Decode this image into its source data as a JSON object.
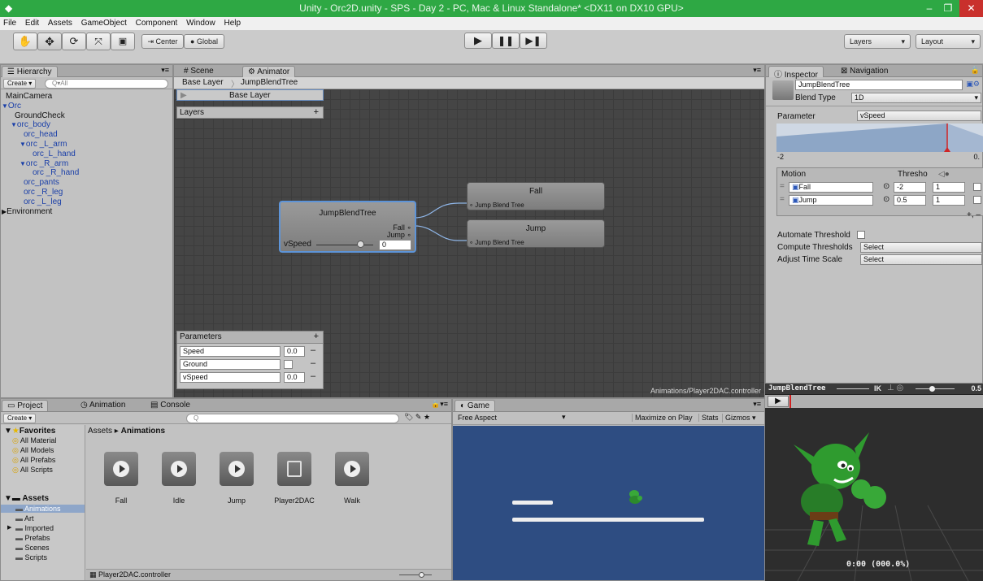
{
  "window": {
    "title": "Unity - Orc2D.unity - SPS - Day 2 - PC, Mac & Linux Standalone* <DX11 on DX10 GPU>",
    "minimize": "–",
    "restore": "❐",
    "close": "✕"
  },
  "menu": [
    "File",
    "Edit",
    "Assets",
    "GameObject",
    "Component",
    "Window",
    "Help"
  ],
  "toolbar": {
    "center": "Center",
    "global": "Global",
    "layers": "Layers",
    "layout": "Layout"
  },
  "hierarchy": {
    "tab": "Hierarchy",
    "create": "Create",
    "search_placeholder": "Q▾All",
    "items": [
      {
        "label": "MainCamera",
        "indent": 0,
        "arrow": "",
        "blue": false
      },
      {
        "label": "Orc",
        "indent": 0,
        "arrow": "▼",
        "blue": true
      },
      {
        "label": "GroundCheck",
        "indent": 1,
        "arrow": "",
        "blue": false
      },
      {
        "label": "orc_body",
        "indent": 1,
        "arrow": "▼",
        "blue": true
      },
      {
        "label": "orc_head",
        "indent": 2,
        "arrow": "",
        "blue": true
      },
      {
        "label": "orc _L_arm",
        "indent": 2,
        "arrow": "▼",
        "blue": true
      },
      {
        "label": "orc_L_hand",
        "indent": 3,
        "arrow": "",
        "blue": true
      },
      {
        "label": "orc _R_arm",
        "indent": 2,
        "arrow": "▼",
        "blue": true
      },
      {
        "label": "orc _R_hand",
        "indent": 3,
        "arrow": "",
        "blue": true
      },
      {
        "label": "orc_pants",
        "indent": 2,
        "arrow": "",
        "blue": true
      },
      {
        "label": "orc _R_leg",
        "indent": 2,
        "arrow": "",
        "blue": true
      },
      {
        "label": "orc _L_leg",
        "indent": 2,
        "arrow": "",
        "blue": true
      },
      {
        "label": "Environment",
        "indent": 0,
        "arrow": "▶",
        "blue": false
      }
    ]
  },
  "animator": {
    "tab_scene": "Scene",
    "tab_animator": "Animator",
    "breadcrumb": [
      "Base Layer",
      "JumpBlendTree"
    ],
    "base_layer": "Base Layer",
    "layers": "Layers",
    "blendtree": {
      "title": "JumpBlendTree",
      "out_fall": "Fall",
      "out_jump": "Jump",
      "param": "vSpeed",
      "value": "0"
    },
    "nodes": [
      {
        "name": "Fall",
        "sub": "Jump Blend Tree"
      },
      {
        "name": "Jump",
        "sub": "Jump Blend Tree"
      }
    ],
    "parameters": {
      "header": "Parameters",
      "rows": [
        {
          "name": "Speed",
          "value": "0.0"
        },
        {
          "name": "Ground",
          "value": ""
        },
        {
          "name": "vSpeed",
          "value": "0.0"
        }
      ]
    },
    "path": "Animations/Player2DAC.controller"
  },
  "inspector": {
    "tab_inspector": "Inspector",
    "tab_navigation": "Navigation",
    "name": "JumpBlendTree",
    "blend_type_label": "Blend Type",
    "blend_type": "1D",
    "parameter_label": "Parameter",
    "parameter": "vSpeed",
    "range_min": "-2",
    "range_max": "0.",
    "motion_header": "Motion",
    "threshold_header": "Thresho",
    "motions": [
      {
        "name": "Fall",
        "threshold": "-2",
        "speed": "1"
      },
      {
        "name": "Jump",
        "threshold": "0.5",
        "speed": "1"
      }
    ],
    "add_remove": "+, –",
    "automate_label": "Automate Threshold",
    "compute_label": "Compute Thresholds",
    "compute_value": "Select",
    "adjust_label": "Adjust Time Scale",
    "adjust_value": "Select"
  },
  "preview": {
    "title": "JumpBlendTree",
    "ik": "IK",
    "value": "0.5",
    "time": "0:00 (000.0%)"
  },
  "project": {
    "tab_project": "Project",
    "tab_animation": "Animation",
    "tab_console": "Console",
    "create": "Create",
    "favorites": "Favorites",
    "fav_items": [
      "All Material",
      "All Models",
      "All Prefabs",
      "All Scripts"
    ],
    "assets_label": "Assets",
    "asset_folders": [
      "Animations",
      "Art",
      "Imported",
      "Prefabs",
      "Scenes",
      "Scripts"
    ],
    "breadcrumb": [
      "Assets",
      "Animations"
    ],
    "files": [
      "Fall",
      "Idle",
      "Jump",
      "Player2DAC",
      "Walk"
    ],
    "selected_file": "Player2DAC.controller"
  },
  "game": {
    "tab": "Game",
    "aspect": "Free Aspect",
    "maximize": "Maximize on Play",
    "stats": "Stats",
    "gizmos": "Gizmos"
  }
}
